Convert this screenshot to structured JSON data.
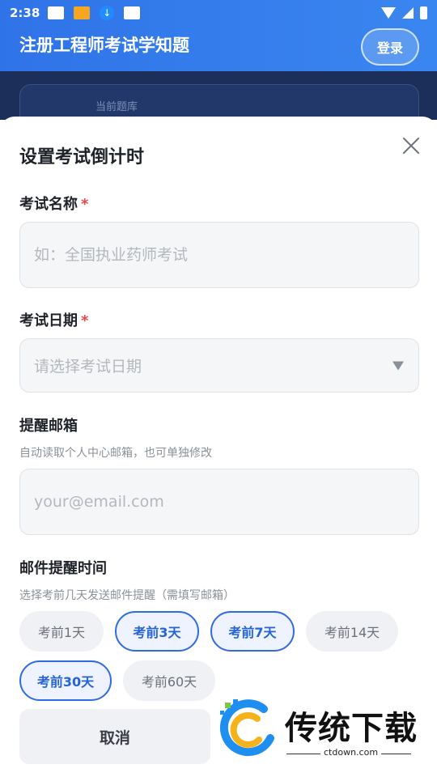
{
  "status_bar": {
    "time": "2:38"
  },
  "app_bar": {
    "title": "注册工程师考试学知题",
    "login_label": "登录"
  },
  "background": {
    "current_bank_label": "当前题库"
  },
  "sheet": {
    "title": "设置考试倒计时",
    "exam_name": {
      "label": "考试名称",
      "required_mark": "*",
      "placeholder": "如：全国执业药师考试"
    },
    "exam_date": {
      "label": "考试日期",
      "required_mark": "*",
      "placeholder": "请选择考试日期"
    },
    "email": {
      "label": "提醒邮箱",
      "hint": "自动读取个人中心邮箱，也可单独修改",
      "placeholder": "your@email.com"
    },
    "reminder": {
      "label": "邮件提醒时间",
      "hint": "选择考前几天发送邮件提醒（需填写邮箱）",
      "options": [
        {
          "label": "考前1天",
          "selected": false
        },
        {
          "label": "考前3天",
          "selected": true
        },
        {
          "label": "考前7天",
          "selected": true
        },
        {
          "label": "考前14天",
          "selected": false
        },
        {
          "label": "考前30天",
          "selected": true
        },
        {
          "label": "考前60天",
          "selected": false
        }
      ]
    },
    "cancel_label": "取消"
  },
  "watermark": {
    "brand": "传统下载",
    "domain": "ctdown.com"
  },
  "colors": {
    "primary": "#2f6be3",
    "required": "#e54848"
  }
}
